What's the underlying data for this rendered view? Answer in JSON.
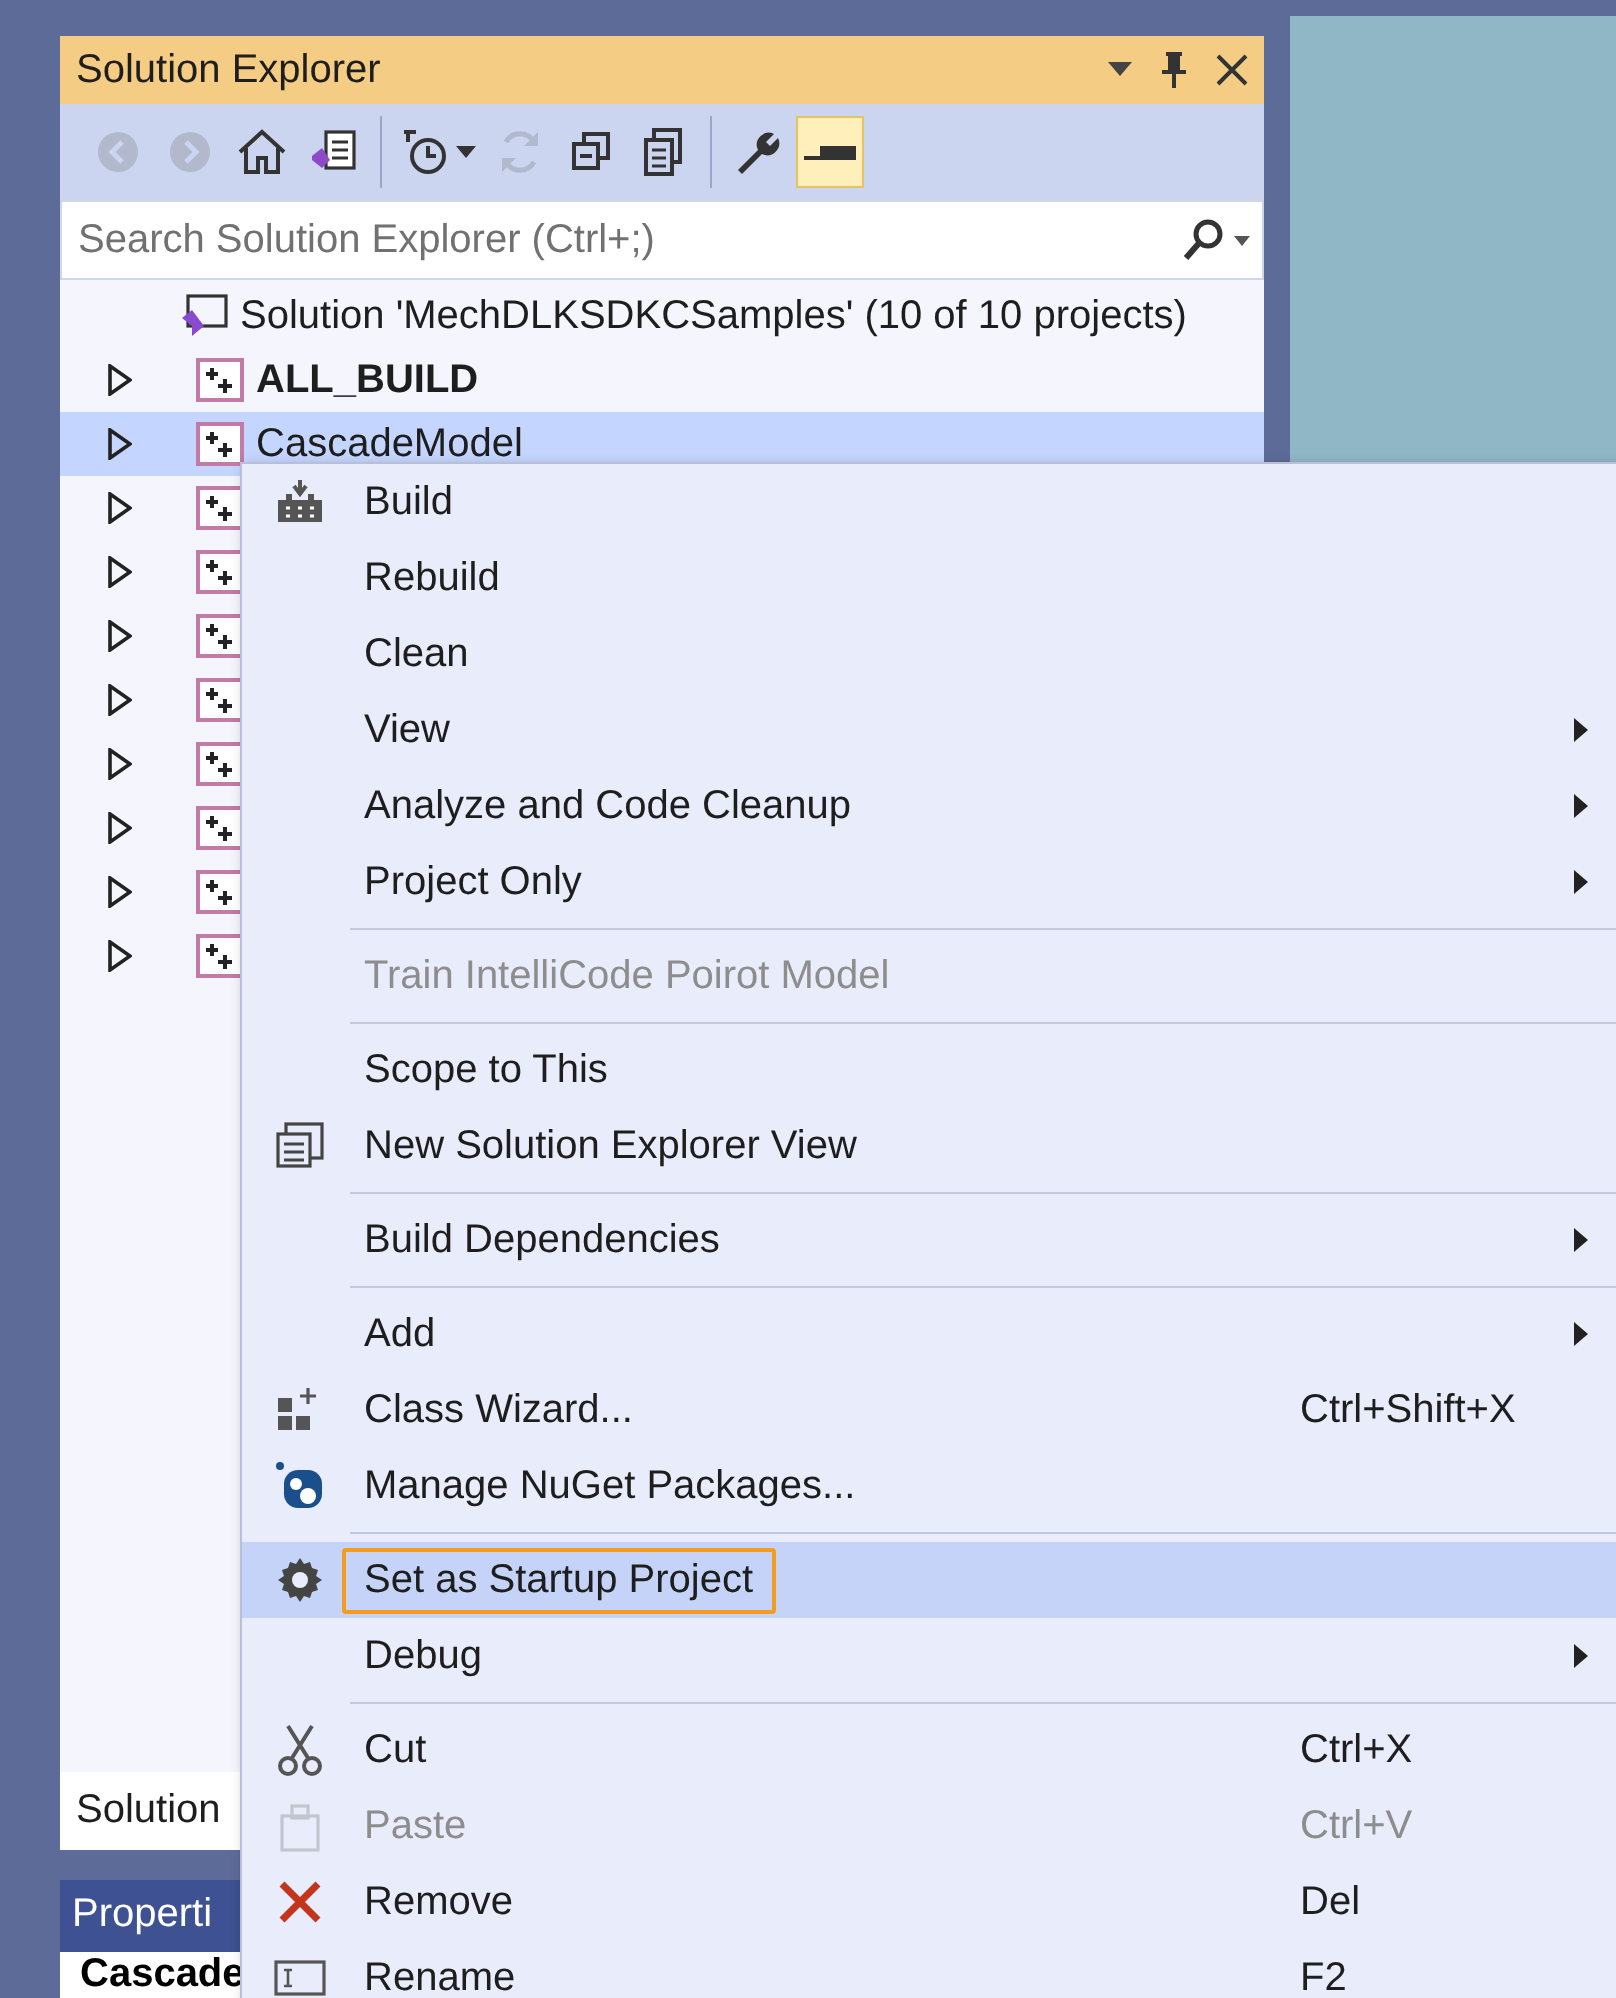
{
  "solution_explorer": {
    "title": "Solution Explorer",
    "title_buttons": [
      {
        "kind": "dropdown"
      },
      {
        "kind": "pin"
      },
      {
        "kind": "close"
      }
    ],
    "toolbar": [
      [
        {
          "kind": "back",
          "disabled": true,
          "active": false
        },
        {
          "kind": "forward",
          "disabled": true,
          "active": false
        },
        {
          "kind": "home",
          "disabled": false,
          "active": false
        },
        {
          "kind": "switch-views",
          "disabled": false,
          "active": false
        }
      ],
      [
        {
          "kind": "history",
          "disabled": false,
          "active": false
        },
        {
          "kind": "refresh",
          "disabled": true,
          "active": false
        },
        {
          "kind": "collapse",
          "disabled": false,
          "active": false
        },
        {
          "kind": "show-all",
          "disabled": false,
          "active": false
        }
      ],
      [
        {
          "kind": "wrench",
          "disabled": false,
          "active": false
        },
        {
          "kind": "preview",
          "disabled": false,
          "active": true
        }
      ]
    ],
    "search": {
      "placeholder": "Search Solution Explorer (Ctrl+;)"
    },
    "tree": [
      {
        "kind": "solution",
        "label": "Solution 'MechDLKSDKCSamples' (10 of 10 projects)",
        "bold": false,
        "selected": false,
        "expanded": true,
        "children": [
          {
            "kind": "project",
            "label": "ALL_BUILD",
            "bold": true,
            "selected": false,
            "expanded": false
          },
          {
            "kind": "project",
            "label": "CascadeModel",
            "bold": false,
            "selected": true,
            "expanded": false
          },
          {
            "kind": "project",
            "selected": false,
            "expanded": false
          },
          {
            "kind": "project",
            "selected": false,
            "expanded": false
          },
          {
            "kind": "project",
            "selected": false,
            "expanded": false
          },
          {
            "kind": "project",
            "selected": false,
            "expanded": false
          },
          {
            "kind": "project",
            "selected": false,
            "expanded": false
          },
          {
            "kind": "project",
            "selected": false,
            "expanded": false
          },
          {
            "kind": "project",
            "selected": false,
            "expanded": false
          },
          {
            "kind": "project",
            "selected": false,
            "expanded": false
          }
        ]
      }
    ],
    "bottom_tab": "Solution"
  },
  "properties": {
    "title": "Properti",
    "object": "Cascade"
  },
  "context_menu": {
    "sections": [
      {
        "items": [
          {
            "kind": "build",
            "label": "Build",
            "submenu": false,
            "disabled": false,
            "selected": false
          },
          {
            "label": "Rebuild",
            "submenu": false,
            "disabled": false,
            "selected": false
          },
          {
            "label": "Clean",
            "submenu": false,
            "disabled": false,
            "selected": false
          },
          {
            "label": "View",
            "submenu": true,
            "disabled": false,
            "selected": false
          },
          {
            "label": "Analyze and Code Cleanup",
            "submenu": true,
            "disabled": false,
            "selected": false
          },
          {
            "label": "Project Only",
            "submenu": true,
            "disabled": false,
            "selected": false
          }
        ]
      },
      {
        "items": [
          {
            "label": "Train IntelliCode Poirot Model",
            "submenu": false,
            "disabled": true,
            "selected": false
          }
        ]
      },
      {
        "items": [
          {
            "label": "Scope to This",
            "submenu": false,
            "disabled": false,
            "selected": false
          },
          {
            "kind": "new-view",
            "label": "New Solution Explorer View",
            "submenu": false,
            "disabled": false,
            "selected": false
          }
        ]
      },
      {
        "items": [
          {
            "label": "Build Dependencies",
            "submenu": true,
            "disabled": false,
            "selected": false
          }
        ]
      },
      {
        "items": [
          {
            "label": "Add",
            "submenu": true,
            "disabled": false,
            "selected": false
          },
          {
            "kind": "class-wizard",
            "label": "Class Wizard...",
            "shortcut": "Ctrl+Shift+X",
            "submenu": false,
            "disabled": false,
            "selected": false
          },
          {
            "kind": "nuget",
            "label": "Manage NuGet Packages...",
            "submenu": false,
            "disabled": false,
            "selected": false
          }
        ]
      },
      {
        "items": [
          {
            "kind": "gear",
            "label": "Set as Startup Project",
            "submenu": false,
            "disabled": false,
            "selected": true
          },
          {
            "label": "Debug",
            "submenu": true,
            "disabled": false,
            "selected": false
          }
        ]
      },
      {
        "items": [
          {
            "kind": "cut",
            "label": "Cut",
            "shortcut": "Ctrl+X",
            "submenu": false,
            "disabled": false,
            "selected": false
          },
          {
            "kind": "paste",
            "label": "Paste",
            "shortcut": "Ctrl+V",
            "submenu": false,
            "disabled": true,
            "selected": false
          },
          {
            "kind": "remove",
            "label": "Remove",
            "shortcut": "Del",
            "submenu": false,
            "disabled": false,
            "selected": false
          },
          {
            "kind": "rename",
            "label": "Rename",
            "shortcut": "F2",
            "submenu": false,
            "disabled": false,
            "selected": false
          }
        ]
      }
    ]
  }
}
